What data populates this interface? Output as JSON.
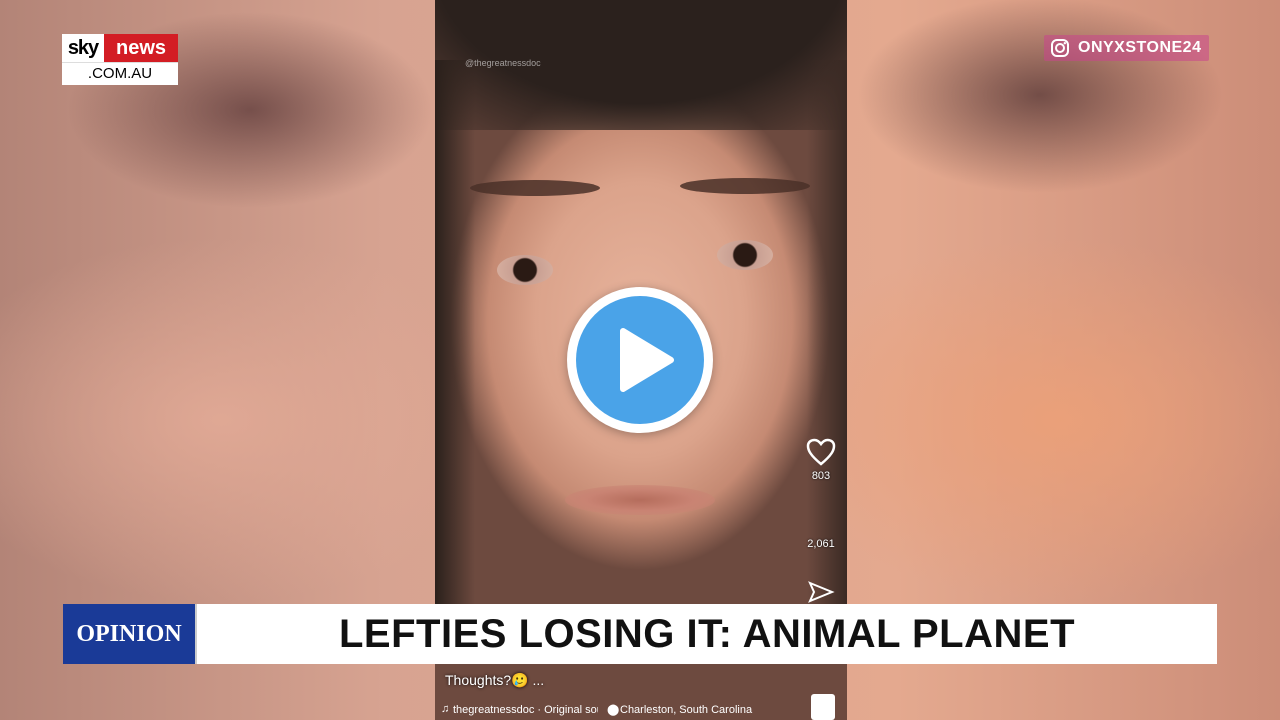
{
  "broadcaster": {
    "logo_sky": "sky",
    "logo_news": "news",
    "logo_domain": ".COM.AU"
  },
  "social": {
    "icon": "instagram-icon",
    "handle": "ONYXSTONE24"
  },
  "video": {
    "play_icon": "play-icon",
    "tiktok": {
      "handle_watermark": "@thegreatnessdoc",
      "likes": "803",
      "comments": "2,061",
      "caption": "Thoughts?🥲 ...",
      "sound": "thegreatnessdoc · Original sound",
      "location": "Charleston, South Carolina"
    }
  },
  "lower_third": {
    "tag": "OPINION",
    "headline": "LEFTIES LOSING IT: ANIMAL PLANET"
  },
  "colors": {
    "sky_red": "#d31d24",
    "opinion_blue": "#1a3a97",
    "play_blue": "#4aa3e8"
  }
}
